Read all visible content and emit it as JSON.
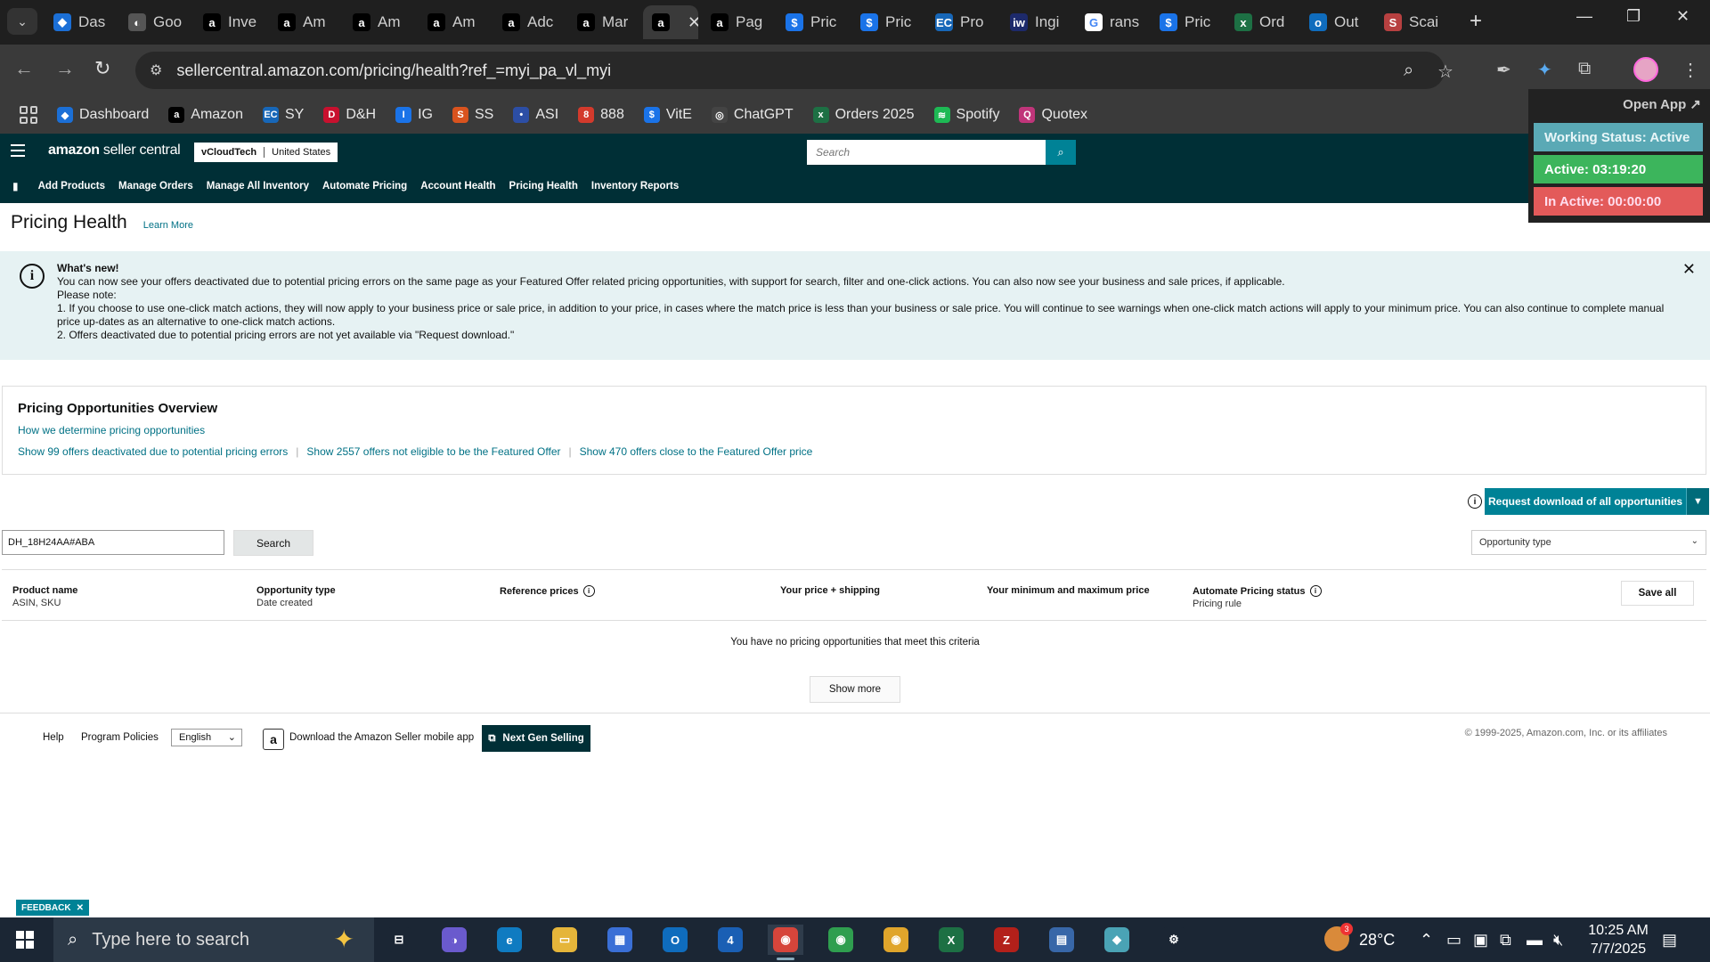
{
  "browser": {
    "tabs": [
      {
        "label": "Das",
        "icon": "dashboard-icon",
        "color": "#1b6fd6",
        "glyph": "◆"
      },
      {
        "label": "Goo",
        "icon": "google-lens-icon",
        "color": "#555555",
        "glyph": "◐"
      },
      {
        "label": "Inve",
        "icon": "amazon-icon",
        "color": "#000000",
        "glyph": "a"
      },
      {
        "label": "Am",
        "icon": "amazon-icon",
        "color": "#000000",
        "glyph": "a"
      },
      {
        "label": "Am",
        "icon": "amazon-icon",
        "color": "#000000",
        "glyph": "a"
      },
      {
        "label": "Am",
        "icon": "amazon-icon",
        "color": "#000000",
        "glyph": "a"
      },
      {
        "label": "Adc",
        "icon": "amazon-icon",
        "color": "#000000",
        "glyph": "a"
      },
      {
        "label": "Mar",
        "icon": "amazon-icon",
        "color": "#000000",
        "glyph": "a"
      },
      {
        "label": "",
        "icon": "amazon-icon",
        "color": "#000000",
        "glyph": "a",
        "active": true
      },
      {
        "label": "Pag",
        "icon": "amazon-icon",
        "color": "#000000",
        "glyph": "a"
      },
      {
        "label": "Pric",
        "icon": "dollar-icon",
        "color": "#1a73e8",
        "glyph": "$"
      },
      {
        "label": "Pric",
        "icon": "dollar-icon",
        "color": "#1a73e8",
        "glyph": "$"
      },
      {
        "label": "Pro",
        "icon": "ec-icon",
        "color": "#1767b8",
        "glyph": "EC"
      },
      {
        "label": "Ingi",
        "icon": "ingram-icon",
        "color": "#1d2a6b",
        "glyph": "iw"
      },
      {
        "label": "rans",
        "icon": "google-icon",
        "color": "#ffffff",
        "glyph": "G"
      },
      {
        "label": "Pric",
        "icon": "dollar-icon",
        "color": "#1a73e8",
        "glyph": "$"
      },
      {
        "label": "Ord",
        "icon": "excel-icon",
        "color": "#1d7044",
        "glyph": "x"
      },
      {
        "label": "Out",
        "icon": "outlook-icon",
        "color": "#0f6cbd",
        "glyph": "o"
      },
      {
        "label": "Scai",
        "icon": "scan-icon",
        "color": "#b74040",
        "glyph": "S"
      }
    ],
    "url": "sellercentral.amazon.com/pricing/health?ref_=myi_pa_vl_myi",
    "bookmarks": [
      {
        "label": "Dashboard",
        "icon": "dashboard-icon",
        "color": "#1b6fd6",
        "glyph": "◆"
      },
      {
        "label": "Amazon",
        "icon": "amazon-icon",
        "color": "#000000",
        "glyph": "a"
      },
      {
        "label": "SY",
        "icon": "ec-icon",
        "color": "#1767b8",
        "glyph": "EC"
      },
      {
        "label": "D&H",
        "icon": "dh-icon",
        "color": "#c8102e",
        "glyph": "D"
      },
      {
        "label": "IG",
        "icon": "ig-icon",
        "color": "#1a73e8",
        "glyph": "I"
      },
      {
        "label": "SS",
        "icon": "ss-icon",
        "color": "#d9531e",
        "glyph": "S"
      },
      {
        "label": "ASI",
        "icon": "asi-icon",
        "color": "#2c4ea5",
        "glyph": "•"
      },
      {
        "label": "888",
        "icon": "888-icon",
        "color": "#d33a2c",
        "glyph": "8"
      },
      {
        "label": "VitE",
        "icon": "dollar-icon",
        "color": "#1a73e8",
        "glyph": "$"
      },
      {
        "label": "ChatGPT",
        "icon": "chatgpt-icon",
        "color": "#444444",
        "glyph": "◎"
      },
      {
        "label": "Orders 2025",
        "icon": "excel-icon",
        "color": "#1d7044",
        "glyph": "x"
      },
      {
        "label": "Spotify",
        "icon": "spotify-icon",
        "color": "#1db954",
        "glyph": "≋"
      },
      {
        "label": "Quotex",
        "icon": "quotex-icon",
        "color": "#c0357a",
        "glyph": "Q"
      }
    ]
  },
  "extension": {
    "open_app": "Open App ↗",
    "working_status": "Working Status: Active",
    "active": "Active: 03:19:20",
    "inactive": "In Active: 00:00:00"
  },
  "header": {
    "logo_bold": "amazon",
    "logo_thin": " seller central",
    "account": "vCloudTech",
    "marketplace": "United States",
    "search_placeholder": "Search"
  },
  "nav": [
    "Add Products",
    "Manage Orders",
    "Manage All Inventory",
    "Automate Pricing",
    "Account Health",
    "Pricing Health",
    "Inventory Reports"
  ],
  "page": {
    "title": "Pricing Health",
    "learn_more": "Learn More"
  },
  "whatsnew": {
    "heading": "What's new!",
    "line1": "You can now see your offers deactivated due to potential pricing errors on the same page as your Featured Offer related pricing opportunities, with support for search, filter and one-click actions. You can also now see your business and sale prices, if applicable.",
    "line2": "Please note:",
    "line3": "1. If you choose to use one-click match actions, they will now apply to your business price or sale price, in addition to your price, in cases where the match price is less than your business or sale price. You will continue to see warnings when one-click match actions will apply to your minimum price. You can also continue to complete manual price up-dates as an alternative to one-click match actions.",
    "line4": "2. Offers deactivated due to potential pricing errors are not yet available via \"Request download.\""
  },
  "overview": {
    "title": "Pricing Opportunities Overview",
    "how": "How we determine pricing opportunities",
    "links": [
      "Show 99 offers deactivated due to potential pricing errors",
      "Show 2557 offers not eligible to be the Featured Offer",
      "Show 470 offers close to the Featured Offer price"
    ]
  },
  "controls": {
    "request_download": "Request download of all opportunities",
    "search_value": "DH_18H24AA#ABA",
    "search_button": "Search",
    "opportunity_type": "Opportunity type"
  },
  "table": {
    "columns": [
      {
        "h": "Product name",
        "s": "ASIN, SKU"
      },
      {
        "h": "Opportunity type",
        "s": "Date created"
      },
      {
        "h": "Reference prices",
        "s": ""
      },
      {
        "h": "Your price + shipping",
        "s": ""
      },
      {
        "h": "Your minimum and maximum price",
        "s": ""
      },
      {
        "h": "Automate Pricing status",
        "s": "Pricing rule"
      }
    ],
    "save_all": "Save all",
    "empty": "You have no pricing opportunities that meet this criteria",
    "show_more": "Show more"
  },
  "footer": {
    "help": "Help",
    "policies": "Program Policies",
    "language": "English",
    "app_download": "Download the Amazon Seller mobile app",
    "next_gen": "Next Gen Selling",
    "copyright": "© 1999-2025, Amazon.com, Inc. or its affiliates"
  },
  "feedback": "FEEDBACK",
  "taskbar": {
    "search_placeholder": "Type here to search",
    "temperature": "28°C",
    "weather_badge": "3",
    "time": "10:25 AM",
    "date": "7/7/2025",
    "apps": [
      {
        "name": "taskview-icon",
        "color": "#1b2634",
        "glyph": "⊟"
      },
      {
        "name": "copilot-icon",
        "color": "#6a5acd",
        "glyph": "◑"
      },
      {
        "name": "edge-icon",
        "color": "#0f7bc1",
        "glyph": "e"
      },
      {
        "name": "file-explorer-icon",
        "color": "#e5b53a",
        "glyph": "▭"
      },
      {
        "name": "store-icon",
        "color": "#3a6fd6",
        "glyph": "▦"
      },
      {
        "name": "outlook-icon",
        "color": "#0f6cbd",
        "glyph": "O"
      },
      {
        "name": "calendar-icon",
        "color": "#1a5fb4",
        "glyph": "4"
      },
      {
        "name": "chrome-icon",
        "color": "#d6453b",
        "glyph": "◉",
        "active": true
      },
      {
        "name": "chrome-icon",
        "color": "#2f9e4f",
        "glyph": "◉"
      },
      {
        "name": "chrome-icon",
        "color": "#e0a52b",
        "glyph": "◉"
      },
      {
        "name": "excel-icon",
        "color": "#1d7044",
        "glyph": "X"
      },
      {
        "name": "filezilla-icon",
        "color": "#b3201a",
        "glyph": "Z"
      },
      {
        "name": "calculator-icon",
        "color": "#3867a8",
        "glyph": "▤"
      },
      {
        "name": "app-icon",
        "color": "#4aa3b5",
        "glyph": "◆"
      },
      {
        "name": "settings-icon",
        "color": "#1b2634",
        "glyph": "⚙"
      }
    ]
  }
}
